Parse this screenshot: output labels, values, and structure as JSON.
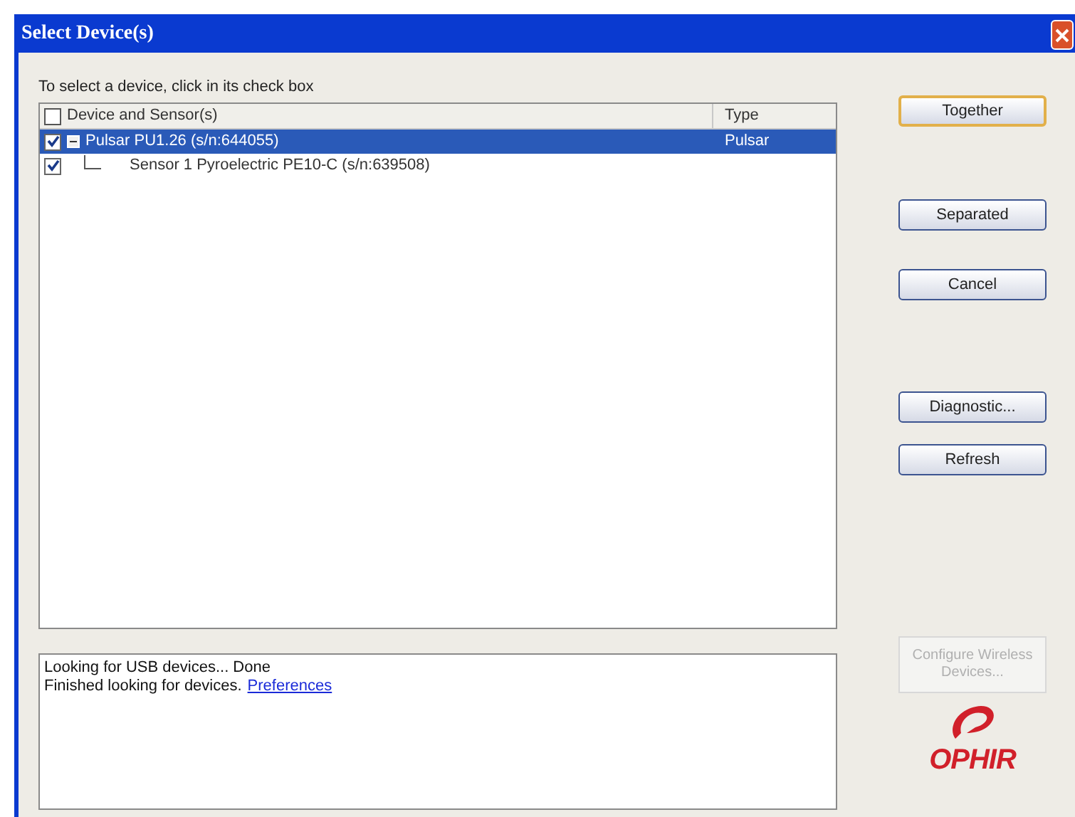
{
  "window": {
    "title": "Select Device(s)"
  },
  "instruction": "To select a device, click in its check box",
  "device_list": {
    "select_all_checked": false,
    "columns": [
      "Device and Sensor(s)",
      "Type"
    ],
    "rows": [
      {
        "label": "Pulsar PU1.26 (s/n:644055)",
        "type": "Pulsar",
        "checked": true,
        "expanded": true,
        "selected": true,
        "children": [
          {
            "label": "Sensor 1 Pyroelectric PE10-C (s/n:639508)",
            "checked": true,
            "selected": false
          }
        ]
      }
    ]
  },
  "log": {
    "lines": [
      "Looking for USB devices... Done",
      "Finished looking for devices."
    ],
    "link": "Preferences"
  },
  "buttons": [
    {
      "label": "Together",
      "focused": true,
      "disabled": false
    },
    {
      "label": "Separated",
      "focused": false,
      "disabled": false
    },
    {
      "label": "Cancel",
      "focused": false,
      "disabled": false
    },
    {
      "label": "Diagnostic...",
      "focused": false,
      "disabled": false
    },
    {
      "label": "Refresh",
      "focused": false,
      "disabled": false
    }
  ],
  "wireless_button": {
    "label": "Configure Wireless Devices...",
    "disabled": true
  },
  "logo": "OPHIR"
}
